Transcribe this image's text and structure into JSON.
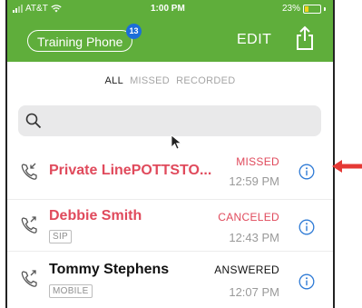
{
  "status_bar": {
    "carrier": "AT&T",
    "time": "1:00 PM",
    "battery": "23%",
    "battery_level": 0.23
  },
  "header": {
    "account_label": "Training Phone",
    "badge_count": "13",
    "edit_label": "EDIT"
  },
  "filter_tabs": {
    "all": "ALL",
    "missed": "MISSED",
    "recorded": "RECORDED",
    "selected": "ALL"
  },
  "search": {
    "placeholder": ""
  },
  "calls": [
    {
      "name": "Private LinePOTTSTO...",
      "tag": "",
      "status": "MISSED",
      "time": "12:59 PM",
      "name_color": "#e04a5c",
      "status_color": "#e04a5c",
      "direction": "incoming"
    },
    {
      "name": "Debbie Smith",
      "tag": "SIP",
      "status": "CANCELED",
      "time": "12:43 PM",
      "name_color": "#e04a5c",
      "status_color": "#e04a5c",
      "direction": "outgoing"
    },
    {
      "name": "Tommy Stephens",
      "tag": "MOBILE",
      "status": "ANSWERED",
      "time": "12:07 PM",
      "name_color": "#111111",
      "status_color": "#111111",
      "direction": "outgoing"
    }
  ],
  "colors": {
    "header_green": "#5fae3b",
    "badge_blue": "#1c6ed8",
    "info_blue": "#2f7bd6",
    "missed_red": "#e04a5c",
    "arrow_red": "#e53935"
  }
}
